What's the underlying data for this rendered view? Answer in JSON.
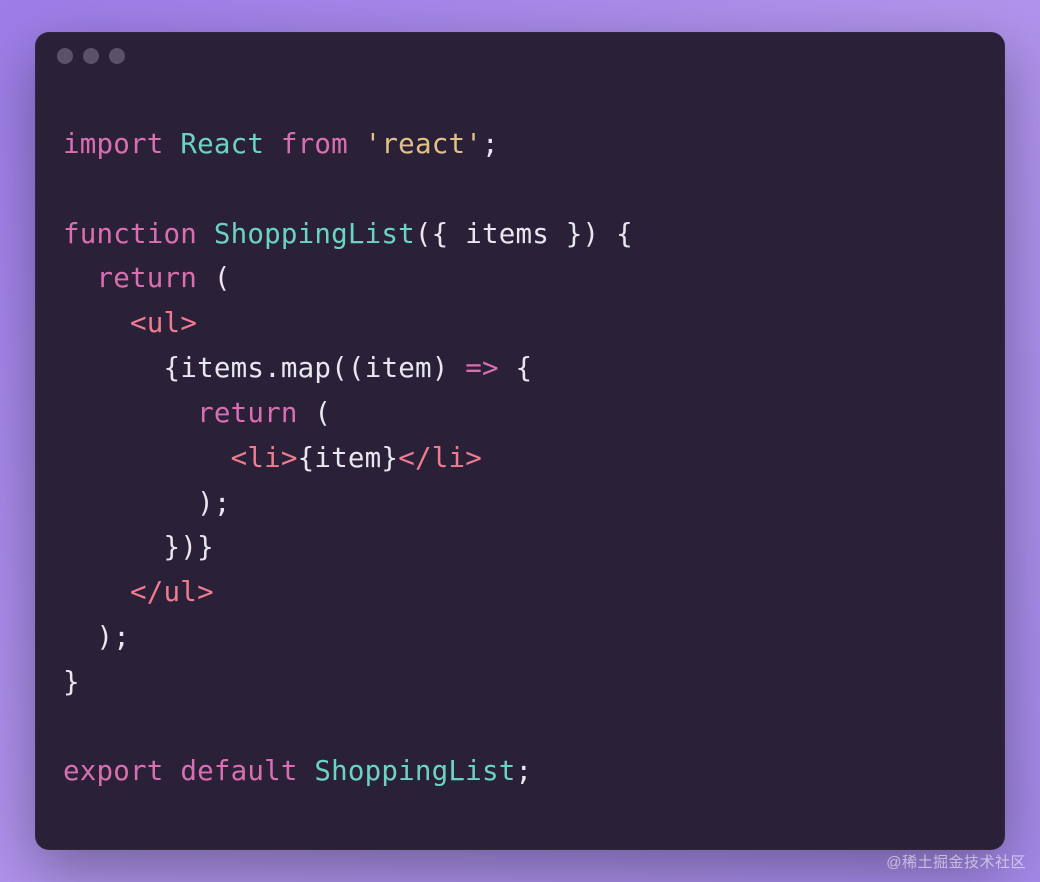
{
  "window": {
    "dots": 3
  },
  "code": {
    "line1": {
      "import": "import",
      "react": "React",
      "from": "from",
      "str": "'react'",
      "semi": ";"
    },
    "line2": "",
    "line3": {
      "func": "function",
      "name": "ShoppingList",
      "lparen": "(",
      "lbrace": "{",
      "param": "items",
      "rbrace": "}",
      "rparen": ")",
      "obrace": "{"
    },
    "line4": {
      "ret": "return",
      "lparen": "("
    },
    "line5": {
      "open": "<",
      "tag": "ul",
      "close": ">"
    },
    "line6": {
      "lbrace": "{",
      "items": "items",
      "dot": ".",
      "map": "map",
      "lparen": "(",
      "lparen2": "(",
      "item": "item",
      "rparen2": ")",
      "arrow": "=>",
      "obrace": "{"
    },
    "line7": {
      "ret": "return",
      "lparen": "("
    },
    "line8": {
      "open": "<",
      "tag": "li",
      "close": ">",
      "lbrace": "{",
      "item": "item",
      "rbrace": "}",
      "open2": "</",
      "tag2": "li",
      "close2": ">"
    },
    "line9": {
      "rparen": ")",
      "semi": ";"
    },
    "line10": {
      "rbrace": "}",
      "rparen": ")",
      "rbrace2": "}"
    },
    "line11": {
      "open": "</",
      "tag": "ul",
      "close": ">"
    },
    "line12": {
      "rparen": ")",
      "semi": ";"
    },
    "line13": {
      "rbrace": "}"
    },
    "line14": "",
    "line15": {
      "export": "export",
      "default": "default",
      "name": "ShoppingList",
      "semi": ";"
    }
  },
  "watermark": "@稀土掘金技术社区"
}
